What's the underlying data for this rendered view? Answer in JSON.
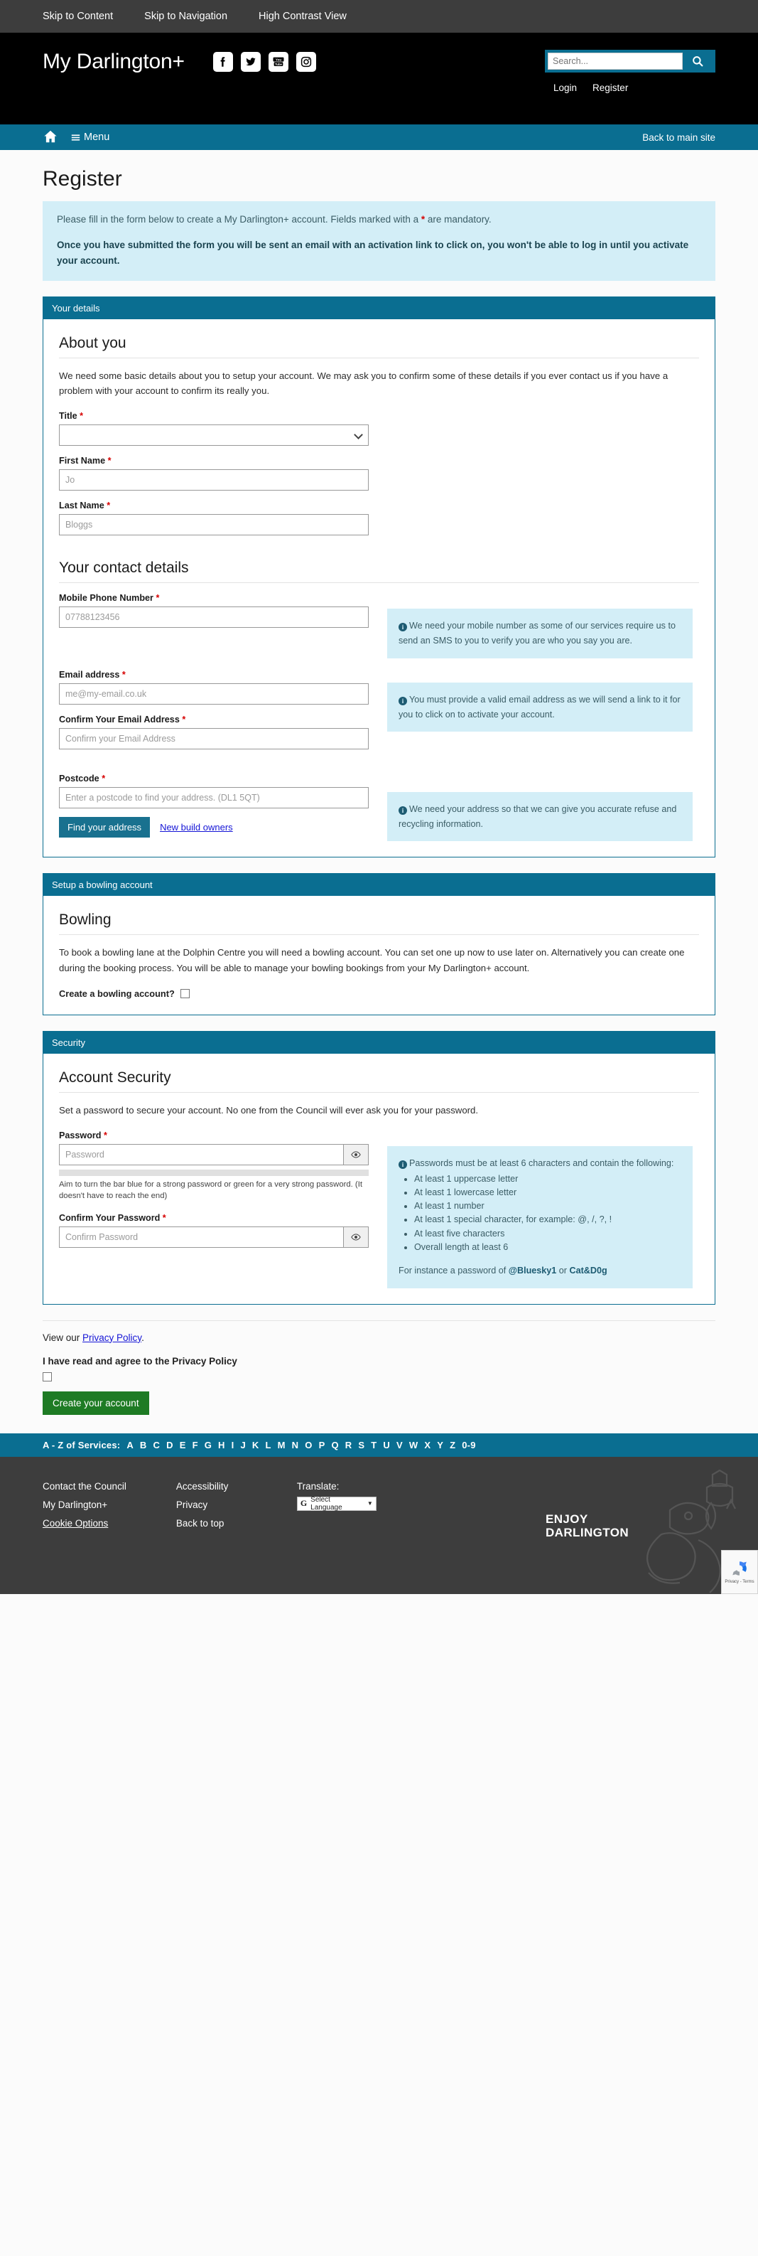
{
  "topbar": {
    "links": [
      "Skip to Content",
      "Skip to Navigation",
      "High Contrast View"
    ]
  },
  "masthead": {
    "brand": "My Darlington+",
    "socials": [
      "facebook-icon",
      "twitter-icon",
      "youtube-icon",
      "instagram-icon"
    ],
    "search_placeholder": "Search...",
    "search_value": "",
    "login": "Login",
    "register": "Register"
  },
  "nav": {
    "home": "home-icon",
    "menu": "Menu",
    "back_to_main": "Back to main site"
  },
  "page": {
    "title": "Register",
    "alert_line1_a": "Please fill in the form below to create a My Darlington+ account. Fields marked with a ",
    "alert_star": "*",
    "alert_line1_b": " are mandatory.",
    "alert_line2": "Once you have submitted the form you will be sent an email with an activation link to click on, you won't be able to log in until you activate your account."
  },
  "your_details": {
    "panel_title": "Your details",
    "about_heading": "About you",
    "about_text": "We need some basic details about you to setup your account. We may ask you to confirm some of these details if you ever contact us if you have a problem with your account to confirm its really you.",
    "title_label": "Title",
    "title_value": "",
    "first_name_label": "First Name",
    "first_name_placeholder": "Jo",
    "last_name_label": "Last Name",
    "last_name_placeholder": "Bloggs",
    "contact_heading": "Your contact details",
    "mobile_label": "Mobile Phone Number",
    "mobile_placeholder": "07788123456",
    "mobile_info": "We need your mobile number as some of our services require us to send an SMS to you to verify you are who you say you are.",
    "email_label": "Email address",
    "email_placeholder": "me@my-email.co.uk",
    "confirm_email_label": "Confirm Your Email Address",
    "confirm_email_placeholder": "Confirm your Email Address",
    "email_info": "You must provide a valid email address as we will send a link to it for you to click on to activate your account.",
    "postcode_label": "Postcode",
    "postcode_placeholder": "Enter a postcode to find your address. (DL1 5QT)",
    "postcode_info": "We need your address so that we can give you accurate refuse and recycling information.",
    "find_address_btn": "Find your address",
    "new_build_link": "New build owners"
  },
  "bowling": {
    "panel_title": "Setup a bowling account",
    "heading": "Bowling",
    "text": "To book a bowling lane at the Dolphin Centre you will need a bowling account. You can set one up now to use later on. Alternatively you can create one during the booking process. You will be able to manage your bowling bookings from your My Darlington+ account.",
    "checkbox_label": "Create a bowling account?",
    "checkbox_checked": false
  },
  "security": {
    "panel_title": "Security",
    "heading": "Account Security",
    "text": "Set a password to secure your account. No one from the Council will ever ask you for your password.",
    "password_label": "Password",
    "password_placeholder": "Password",
    "strength_hint": "Aim to turn the bar blue for a strong password or green for a very strong password. (It doesn't have to reach the end)",
    "confirm_label": "Confirm Your Password",
    "confirm_placeholder": "Confirm Password",
    "info_intro": "Passwords must be at least 6 characters and contain the following:",
    "info_bullets": [
      "At least 1 uppercase letter",
      "At least 1 lowercase letter",
      "At least 1 number",
      "At least 1 special character, for example: @, /, ?, !",
      "At least five characters",
      "Overall length at least 6"
    ],
    "example_prefix": "For instance a password of ",
    "example_1": "@Bluesky1",
    "example_mid": " or ",
    "example_2": "Cat&D0g"
  },
  "submit": {
    "view_prefix": "View our ",
    "privacy_link": "Privacy Policy",
    "view_suffix": ".",
    "agree_label": "I have read and agree to the Privacy Policy",
    "agree_checked": false,
    "create_btn": "Create your account"
  },
  "az": {
    "label": "A - Z of Services:",
    "letters": [
      "A",
      "B",
      "C",
      "D",
      "E",
      "F",
      "G",
      "H",
      "I",
      "J",
      "K",
      "L",
      "M",
      "N",
      "O",
      "P",
      "Q",
      "R",
      "S",
      "T",
      "U",
      "V",
      "W",
      "X",
      "Y",
      "Z",
      "0-9"
    ]
  },
  "footer": {
    "col1": [
      "Contact the Council",
      "My Darlington+",
      "Cookie Options"
    ],
    "col2": [
      "Accessibility",
      "Privacy",
      "Back to top"
    ],
    "translate_label": "Translate:",
    "translate_value": "Select Language",
    "enjoy_line1": "ENJOY",
    "enjoy_line2": "DARLINGTON",
    "recaptcha_text": "Privacy - Terms"
  },
  "colors": {
    "teal": "#0a6e91",
    "dark": "#3d3d3d",
    "info_bg": "#d3eef7",
    "green": "#1e7b24",
    "required_red": "#d60000",
    "link_blue": "#1414d6"
  }
}
